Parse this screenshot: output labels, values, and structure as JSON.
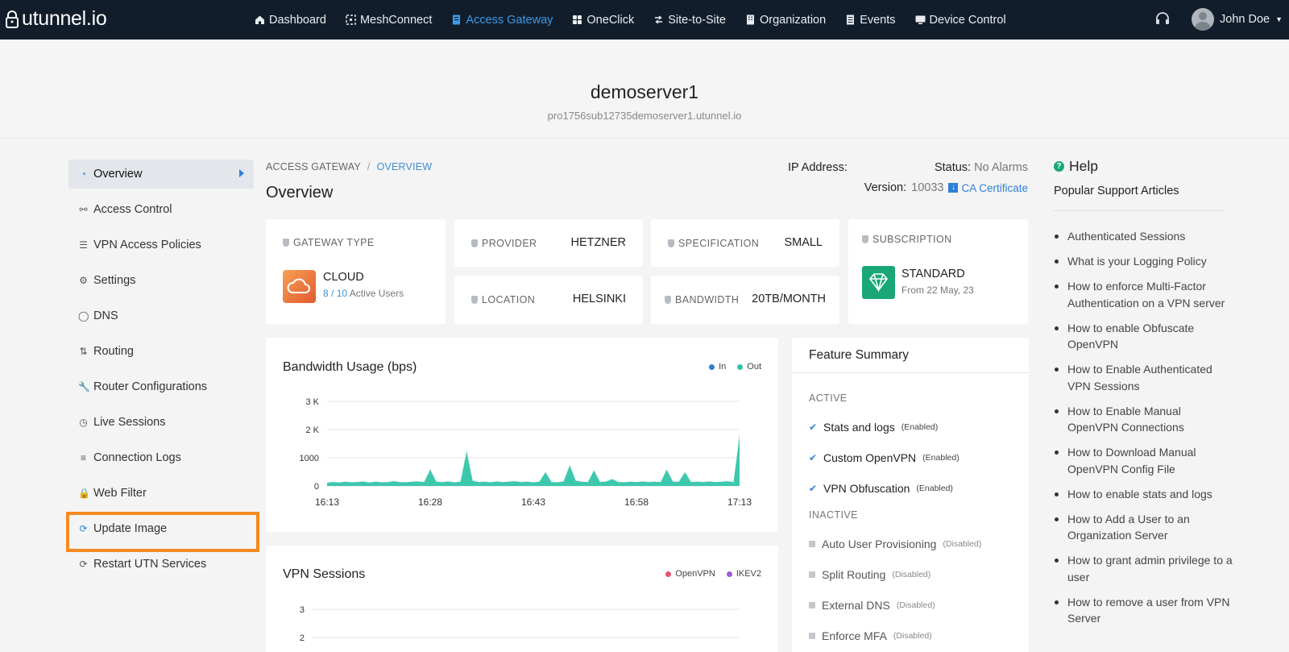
{
  "brand": {
    "name": "utunnel.io"
  },
  "nav": {
    "items": [
      {
        "label": "Dashboard",
        "icon": "home-icon"
      },
      {
        "label": "MeshConnect",
        "icon": "mesh-icon"
      },
      {
        "label": "Access Gateway",
        "icon": "gateway-icon",
        "active": true
      },
      {
        "label": "OneClick",
        "icon": "grid-icon"
      },
      {
        "label": "Site-to-Site",
        "icon": "link-icon"
      },
      {
        "label": "Organization",
        "icon": "building-icon"
      },
      {
        "label": "Events",
        "icon": "list-icon"
      },
      {
        "label": "Device Control",
        "icon": "monitor-icon"
      }
    ],
    "user": "John Doe"
  },
  "header": {
    "server_name": "demoserver1",
    "host": "pro1756sub12735demoserver1.utunnel.io"
  },
  "sidebar": {
    "items": [
      {
        "label": "Overview",
        "icon": "clock-pie-icon",
        "active": true
      },
      {
        "label": "Access Control",
        "icon": "user-icon"
      },
      {
        "label": "VPN Access Policies",
        "icon": "list-icon"
      },
      {
        "label": "Settings",
        "icon": "gear-icon"
      },
      {
        "label": "DNS",
        "icon": "globe-icon"
      },
      {
        "label": "Routing",
        "icon": "routing-icon"
      },
      {
        "label": "Router Configurations",
        "icon": "wrench-icon"
      },
      {
        "label": "Live Sessions",
        "icon": "clock-icon"
      },
      {
        "label": "Connection Logs",
        "icon": "logs-icon"
      },
      {
        "label": "Web Filter",
        "icon": "lock-icon"
      },
      {
        "label": "Update Image",
        "icon": "update-icon"
      },
      {
        "label": "Restart UTN Services",
        "icon": "restart-icon"
      }
    ]
  },
  "breadcrumb": {
    "root": "ACCESS GATEWAY",
    "separator": "/",
    "current": "OVERVIEW"
  },
  "page": {
    "title": "Overview",
    "ip_label": "IP Address:",
    "status_label": "Status:",
    "status_value": "No Alarms",
    "version_label": "Version:",
    "version_value": "10033",
    "ca_certificate": "CA Certificate"
  },
  "cards": {
    "gateway_type": {
      "label": "GATEWAY TYPE",
      "value": "CLOUD",
      "users_active": "8",
      "users_sep": "/",
      "users_total": "10",
      "users_suffix": "Active Users"
    },
    "provider": {
      "label": "PROVIDER",
      "value": "HETZNER"
    },
    "specification": {
      "label": "SPECIFICATION",
      "value": "SMALL"
    },
    "location": {
      "label": "LOCATION",
      "value": "HELSINKI"
    },
    "bandwidth": {
      "label": "BANDWIDTH",
      "value": "20TB/MONTH"
    },
    "subscription": {
      "label": "SUBSCRIPTION",
      "value": "STANDARD",
      "since": "From 22 May, 23"
    }
  },
  "chart_data": [
    {
      "type": "area",
      "title": "Bandwidth Usage (bps)",
      "legend": [
        "In",
        "Out"
      ],
      "legend_position": "top-right",
      "colors": {
        "In": "#2f7fd6",
        "Out": "#2ec4a6"
      },
      "yticks": [
        "3 K",
        "2 K",
        "1000",
        "0"
      ],
      "ylim": [
        0,
        3000
      ],
      "xticks": [
        "16:13",
        "16:28",
        "16:43",
        "16:58",
        "17:13"
      ],
      "series": [
        {
          "name": "Out",
          "values": [
            120,
            150,
            130,
            160,
            140,
            150,
            170,
            130,
            160,
            140,
            150,
            180,
            150,
            140,
            160,
            170,
            150,
            620,
            160,
            150,
            170,
            140,
            160,
            1300,
            200,
            150,
            160,
            140,
            170,
            150,
            160,
            180,
            150,
            160,
            140,
            160,
            520,
            150,
            140,
            170,
            780,
            200,
            160,
            150,
            590,
            150,
            170,
            260,
            150,
            140,
            160,
            150,
            170,
            150,
            160,
            150,
            620,
            160,
            160,
            520,
            150,
            160,
            150,
            170,
            150,
            160,
            180,
            150,
            1900
          ]
        }
      ]
    },
    {
      "type": "line",
      "title": "VPN Sessions",
      "legend": [
        "OpenVPN",
        "IKEV2"
      ],
      "legend_position": "top-right",
      "colors": {
        "OpenVPN": "#e4576b",
        "IKEV2": "#a05ad8"
      },
      "yticks": [
        "3",
        "2"
      ]
    }
  ],
  "features": {
    "title": "Feature Summary",
    "active_label": "ACTIVE",
    "active": [
      {
        "label": "Stats and logs",
        "state": "(Enabled)"
      },
      {
        "label": "Custom OpenVPN",
        "state": "(Enabled)"
      },
      {
        "label": "VPN Obfuscation",
        "state": "(Enabled)"
      }
    ],
    "inactive_label": "INACTIVE",
    "inactive": [
      {
        "label": "Auto User Provisioning",
        "state": "(Disabled)"
      },
      {
        "label": "Split Routing",
        "state": "(Disabled)"
      },
      {
        "label": "External DNS",
        "state": "(Disabled)"
      },
      {
        "label": "Enforce MFA",
        "state": "(Disabled)"
      }
    ]
  },
  "help": {
    "title": "Help",
    "subtitle": "Popular Support Articles",
    "articles": [
      "Authenticated Sessions",
      "What is your Logging Policy",
      "How to enforce Multi-Factor Authentication on a VPN server",
      "How to enable Obfuscate OpenVPN",
      "How to Enable Authenticated VPN Sessions",
      "How to Enable Manual OpenVPN Connections",
      "How to Download Manual OpenVPN Config File",
      "How to enable stats and logs",
      "How to Add a User to an Organization Server",
      "How to grant admin privilege to a user",
      "How to remove a user from VPN Server"
    ]
  }
}
